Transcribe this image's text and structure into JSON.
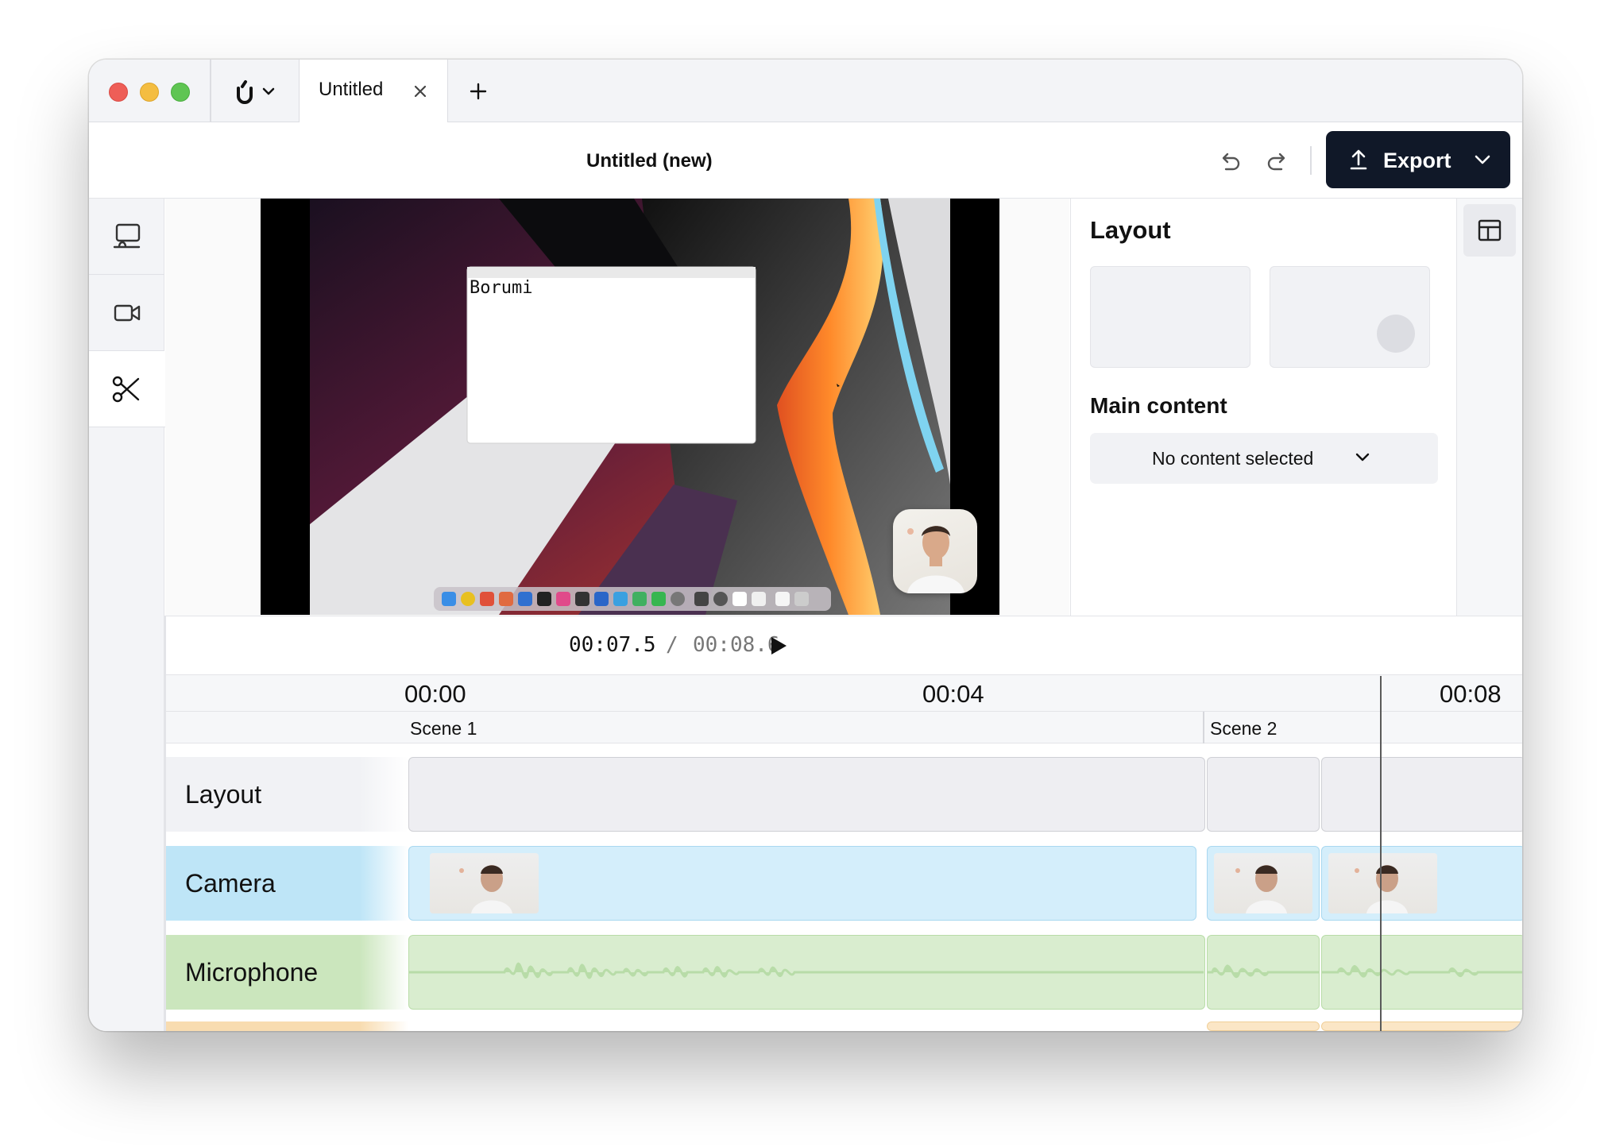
{
  "window": {
    "tab_title": "Untitled",
    "doc_title": "Untitled (new)"
  },
  "toolbar": {
    "export_label": "Export"
  },
  "sidebar": {
    "items": [
      {
        "name": "presentation-icon"
      },
      {
        "name": "camera-icon"
      },
      {
        "name": "scissors-icon"
      }
    ]
  },
  "preview": {
    "notes_window_text": "Borumi"
  },
  "right_panel": {
    "layout_heading": "Layout",
    "main_content_heading": "Main content",
    "content_select_value": "No content selected"
  },
  "playback": {
    "current_time": "00:07.5",
    "separator": "/",
    "total_time": "00:08.6"
  },
  "timeline": {
    "ruler_ticks": [
      "00:00",
      "00:04",
      "00:08"
    ],
    "scenes": [
      "Scene 1",
      "Scene 2"
    ],
    "tracks": [
      "Layout",
      "Camera",
      "Microphone"
    ]
  },
  "colors": {
    "export_bg": "#101828",
    "camera_track": "#d4eefb",
    "camera_label": "#bee5f7",
    "mic_track": "#d9edcf",
    "mic_label": "#cbe6bd",
    "mic_wave": "#b8dca8",
    "layout_track": "#eeeef2"
  }
}
